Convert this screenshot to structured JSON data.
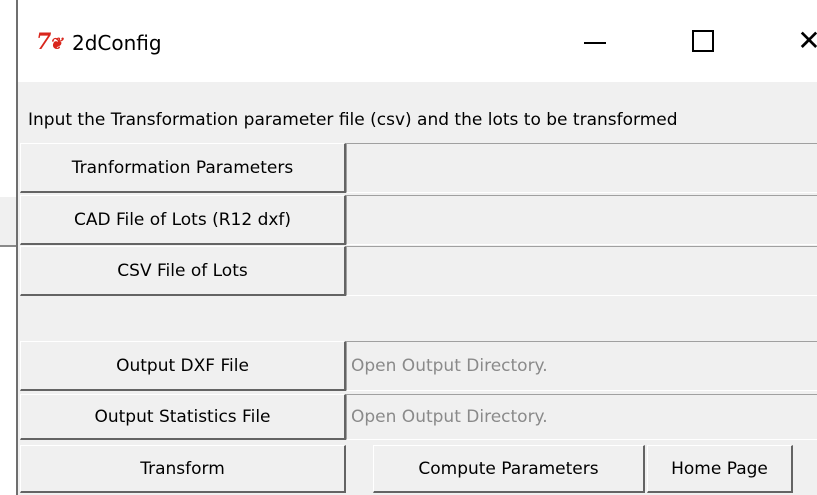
{
  "window": {
    "title": "2dConfig",
    "icon": "tk-feather-icon"
  },
  "instruction_text": "Input the Transformation parameter file (csv) and the lots to be transformed",
  "rows": [
    {
      "button_label": "Tranformation Parameters",
      "field_value": ""
    },
    {
      "button_label": "CAD File of Lots (R12 dxf)",
      "field_value": ""
    },
    {
      "button_label": "CSV File of Lots",
      "field_value": ""
    },
    {
      "button_label": "Output DXF File",
      "field_value": "Open Output Directory."
    },
    {
      "button_label": "Output Statistics File",
      "field_value": "Open Output Directory."
    }
  ],
  "bottom_bar": {
    "transform_label": "Transform",
    "compute_label": "Compute Parameters",
    "home_label": "Home Page"
  }
}
